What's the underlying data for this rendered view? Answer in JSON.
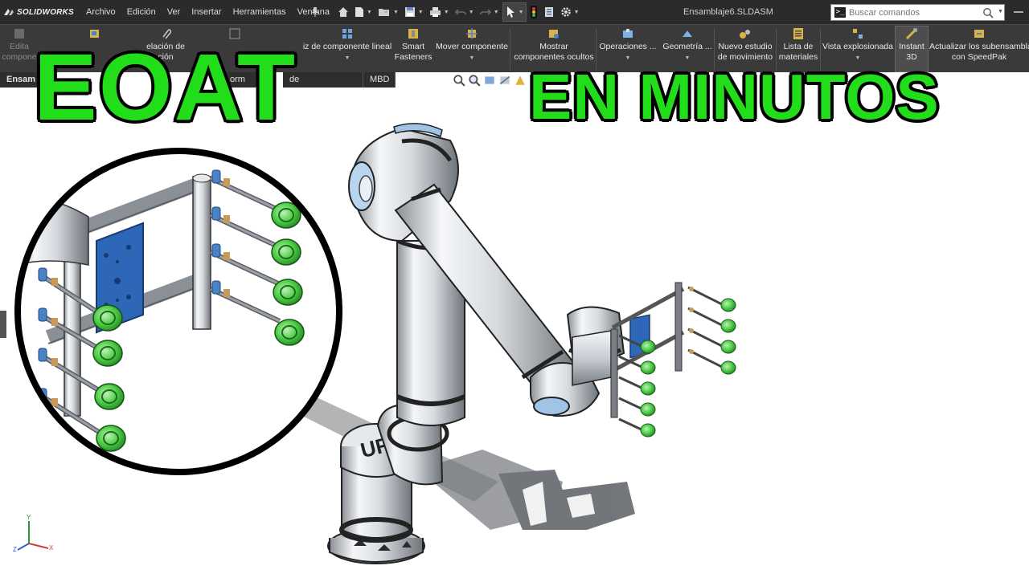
{
  "titlebar": {
    "brand": "SOLIDWORKS",
    "menus": [
      "Archivo",
      "Edición",
      "Ver",
      "Insertar",
      "Herramientas",
      "Ventana"
    ],
    "document_title": "Ensamblaje6.SLDASM",
    "search_placeholder": "Buscar comandos"
  },
  "ribbon": {
    "buttons": [
      {
        "label1": "Edita",
        "label2": "compone",
        "state": "disabled"
      },
      {
        "label1": "elación de",
        "label2": "ción",
        "state": "normal"
      },
      {
        "label1": "iz de componente lineal",
        "label2": "",
        "state": "normal"
      },
      {
        "label1": "Smart",
        "label2": "Fasteners",
        "state": "normal"
      },
      {
        "label1": "Mover componente",
        "label2": "",
        "state": "normal"
      },
      {
        "label1": "Mostrar",
        "label2": "componentes ocultos",
        "state": "normal"
      },
      {
        "label1": "Operaciones ...",
        "label2": "",
        "state": "normal"
      },
      {
        "label1": "Geometría ...",
        "label2": "",
        "state": "normal"
      },
      {
        "label1": "Nuevo estudio",
        "label2": "de movimiento",
        "state": "normal"
      },
      {
        "label1": "Lista de",
        "label2": "materiales",
        "state": "normal"
      },
      {
        "label1": "Vista explosionada",
        "label2": "",
        "state": "normal"
      },
      {
        "label1": "Instant",
        "label2": "3D",
        "state": "active"
      },
      {
        "label1": "Actualizar los subensamblajes",
        "label2": "con SpeedPak",
        "state": "normal"
      }
    ]
  },
  "tabs": [
    "Ensam",
    "orm",
    "de SOLIDWORKS",
    "MBD"
  ],
  "overlay": {
    "headline_left": "EOAT",
    "headline_right": "EN MINUTOS"
  },
  "robot": {
    "base_logo": "UR"
  },
  "triad": {
    "x": "X",
    "y": "Y",
    "z": "Z"
  },
  "colors": {
    "titlebar": "#2b2b2b",
    "ribbon": "#3a3a3a",
    "headline_fill": "#22dd1a",
    "headline_outline": "#000000",
    "suction_cup": "#3fc43f",
    "mounting_plate": "#2f67b8",
    "robot_body": "#e9ecef",
    "robot_joint_accent": "#9fc4e6"
  }
}
